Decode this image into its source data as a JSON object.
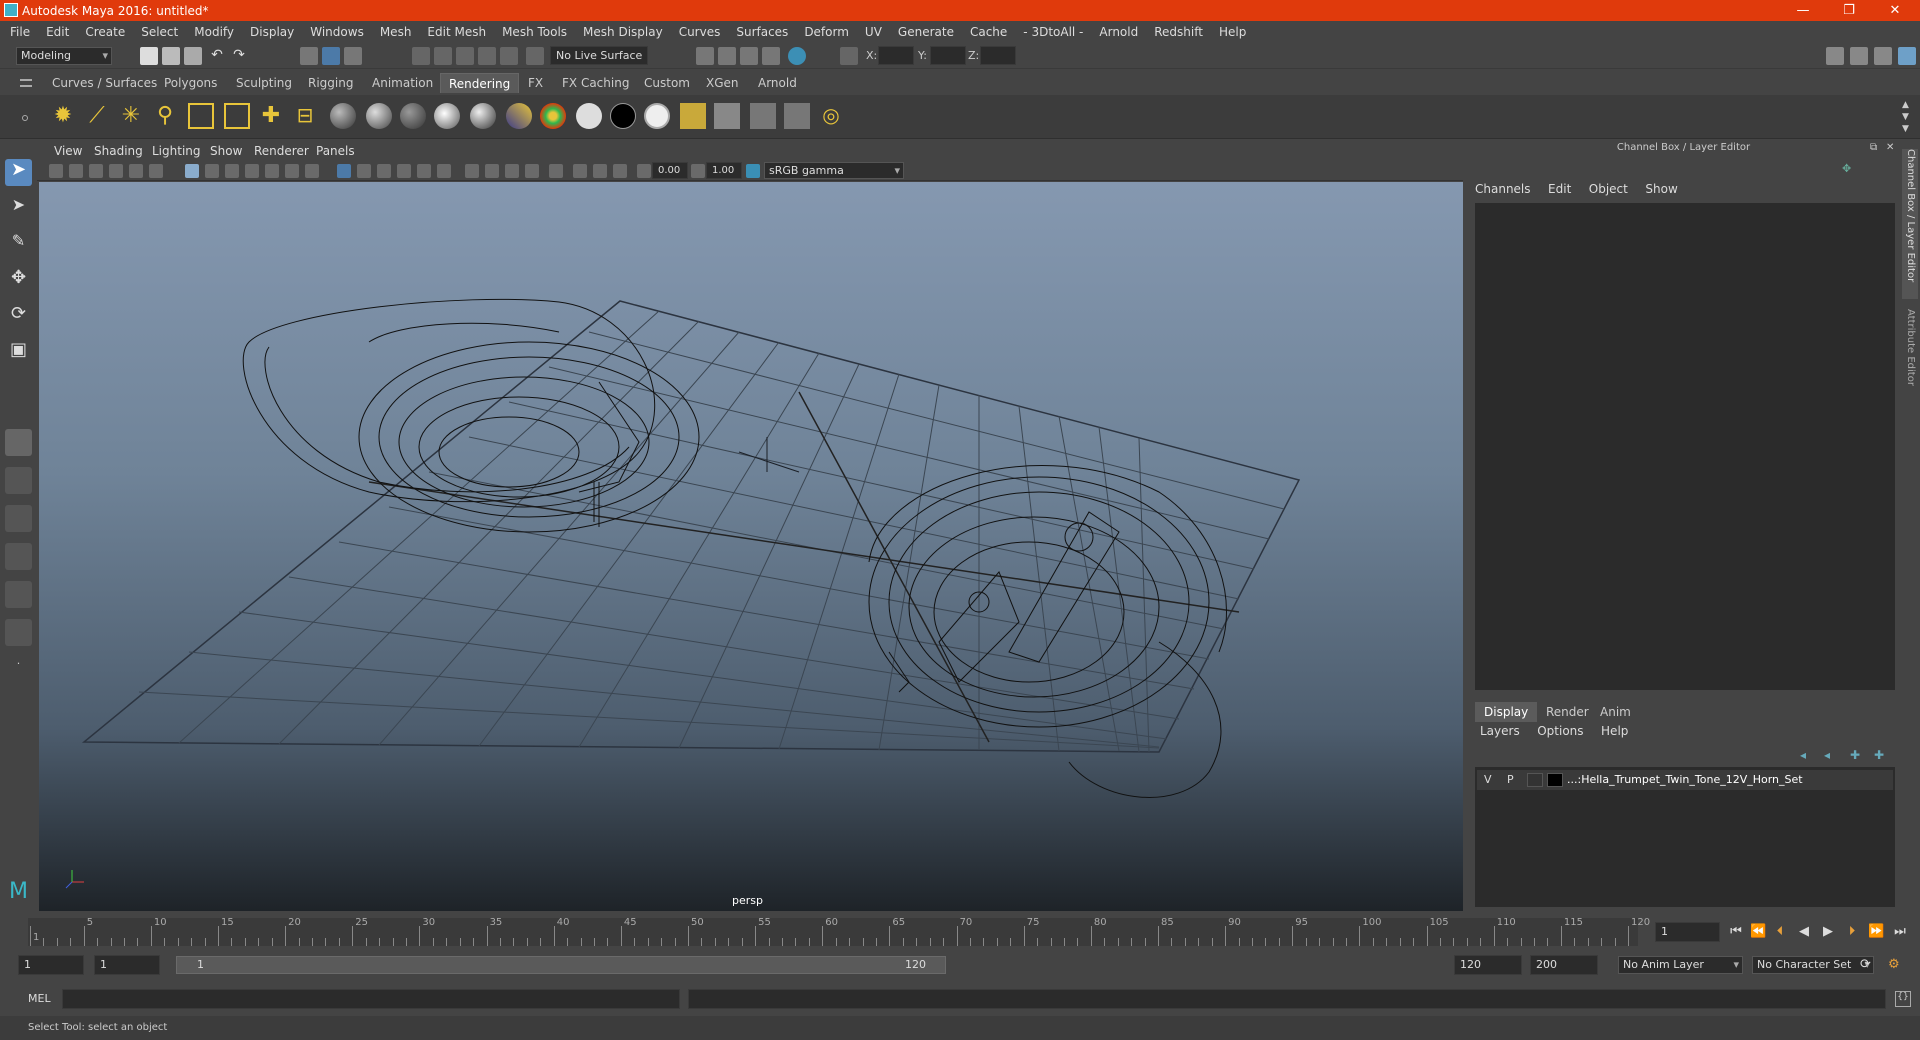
{
  "window": {
    "title": "Autodesk Maya 2016: untitled*"
  },
  "menubar": [
    "File",
    "Edit",
    "Create",
    "Select",
    "Modify",
    "Display",
    "Windows",
    "Mesh",
    "Edit Mesh",
    "Mesh Tools",
    "Mesh Display",
    "Curves",
    "Surfaces",
    "Deform",
    "UV",
    "Generate",
    "Cache",
    "- 3DtoAll -",
    "Arnold",
    "Redshift",
    "Help"
  ],
  "statusline": {
    "menuset": "Modeling",
    "live_surface": "No Live Surface",
    "x_label": "X:",
    "y_label": "Y:",
    "z_label": "Z:"
  },
  "shelf_tabs": [
    "Curves / Surfaces",
    "Polygons",
    "Sculpting",
    "Rigging",
    "Animation",
    "Rendering",
    "FX",
    "FX Caching",
    "Custom",
    "XGen",
    "Arnold"
  ],
  "shelf_active": "Rendering",
  "viewport": {
    "menu": [
      "View",
      "Shading",
      "Lighting",
      "Show",
      "Renderer",
      "Panels"
    ],
    "exposure": "0.00",
    "gamma": "1.00",
    "color_space": "sRGB gamma",
    "camera_label": "persp"
  },
  "right_panel": {
    "title": "Channel Box / Layer Editor",
    "menu": [
      "Channels",
      "Edit",
      "Object",
      "Show"
    ],
    "layer_tabs": [
      "Display",
      "Render",
      "Anim"
    ],
    "layer_tab_active": "Display",
    "layer_menu": [
      "Layers",
      "Options",
      "Help"
    ],
    "layer": {
      "v": "V",
      "p": "P",
      "name": "...:Hella_Trumpet_Twin_Tone_12V_Horn_Set"
    },
    "side_tabs": [
      "Channel Box / Layer Editor",
      "Attribute Editor"
    ]
  },
  "timeline": {
    "ticks": [
      1,
      5,
      10,
      15,
      20,
      25,
      30,
      35,
      40,
      45,
      50,
      55,
      60,
      65,
      70,
      75,
      80,
      85,
      90,
      95,
      100,
      105,
      110,
      115,
      120
    ],
    "current_frame": "1"
  },
  "range": {
    "start": "1",
    "playback_start": "1",
    "slider_start": "1",
    "slider_end": "120",
    "playback_end": "120",
    "end": "200",
    "anim_layer": "No Anim Layer",
    "character_set": "No Character Set"
  },
  "cmdline": {
    "label": "MEL"
  },
  "helpline": {
    "text": "Select Tool: select an object"
  }
}
